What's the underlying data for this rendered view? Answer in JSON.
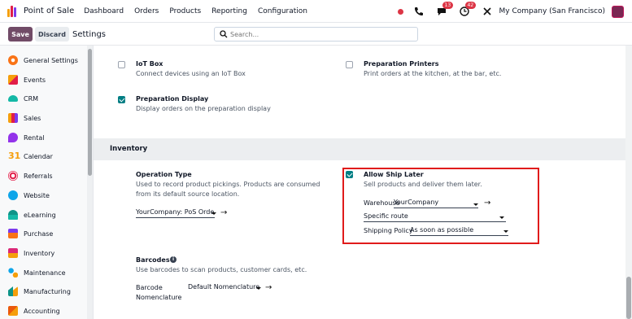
{
  "navbar": {
    "app_name": "Point of Sale",
    "menus": [
      "Dashboard",
      "Orders",
      "Products",
      "Reporting",
      "Configuration"
    ],
    "chat_badge": "13",
    "activity_badge": "42",
    "company": "My Company (San Francisco)"
  },
  "control": {
    "save_label": "Save",
    "discard_label": "Discard",
    "title": "Settings",
    "search_placeholder": "Search..."
  },
  "sidebar": {
    "items": [
      {
        "label": "General Settings",
        "icon": "general-settings-icon",
        "color": "#f97316"
      },
      {
        "label": "Events",
        "icon": "events-icon",
        "color": "#f59e0b"
      },
      {
        "label": "CRM",
        "icon": "crm-icon",
        "color": "#14b8a6"
      },
      {
        "label": "Sales",
        "icon": "sales-icon",
        "color": "#f59e0b"
      },
      {
        "label": "Rental",
        "icon": "rental-icon",
        "color": "#9333ea"
      },
      {
        "label": "Calendar",
        "icon": "calendar-icon",
        "color": "#f59e0b"
      },
      {
        "label": "Referrals",
        "icon": "referrals-icon",
        "color": "#e11d48"
      },
      {
        "label": "Website",
        "icon": "website-icon",
        "color": "#0ea5e9"
      },
      {
        "label": "eLearning",
        "icon": "elearning-icon",
        "color": "#0d9488"
      },
      {
        "label": "Purchase",
        "icon": "purchase-icon",
        "color": "#f97316"
      },
      {
        "label": "Inventory",
        "icon": "inventory-icon",
        "color": "#db2777"
      },
      {
        "label": "Maintenance",
        "icon": "maintenance-icon",
        "color": "#0ea5e9"
      },
      {
        "label": "Manufacturing",
        "icon": "manufacturing-icon",
        "color": "#f59e0b"
      },
      {
        "label": "Accounting",
        "icon": "accounting-icon",
        "color": "#ea580c"
      }
    ]
  },
  "settings": {
    "iot_box": {
      "title": "IoT Box",
      "desc": "Connect devices using an IoT Box",
      "checked": false
    },
    "prep_printers": {
      "title": "Preparation Printers",
      "desc": "Print orders at the kitchen, at the bar, etc.",
      "checked": false
    },
    "prep_display": {
      "title": "Preparation Display",
      "desc": "Display orders on the preparation display",
      "checked": true
    },
    "inventory_heading": "Inventory",
    "operation_type": {
      "title": "Operation Type",
      "desc": "Used to record product pickings. Products are consumed from its default source location.",
      "value": "YourCompany: PoS Orde"
    },
    "allow_ship_later": {
      "title": "Allow Ship Later",
      "desc": "Sell products and deliver them later.",
      "checked": true,
      "warehouse_label": "Warehouse",
      "warehouse_value": "YourCompany",
      "route_value": "Specific route",
      "policy_label": "Shipping Policy",
      "policy_value": "As soon as possible"
    },
    "barcodes": {
      "title": "Barcodes",
      "desc": "Use barcodes to scan products, customer cards, etc.",
      "label_line1": "Barcode",
      "label_line2": "Nomenclature",
      "value": "Default Nomenclature"
    }
  },
  "colors": {
    "brand": "#714b67",
    "accent": "#017e84",
    "highlight": "#e01b1b"
  }
}
